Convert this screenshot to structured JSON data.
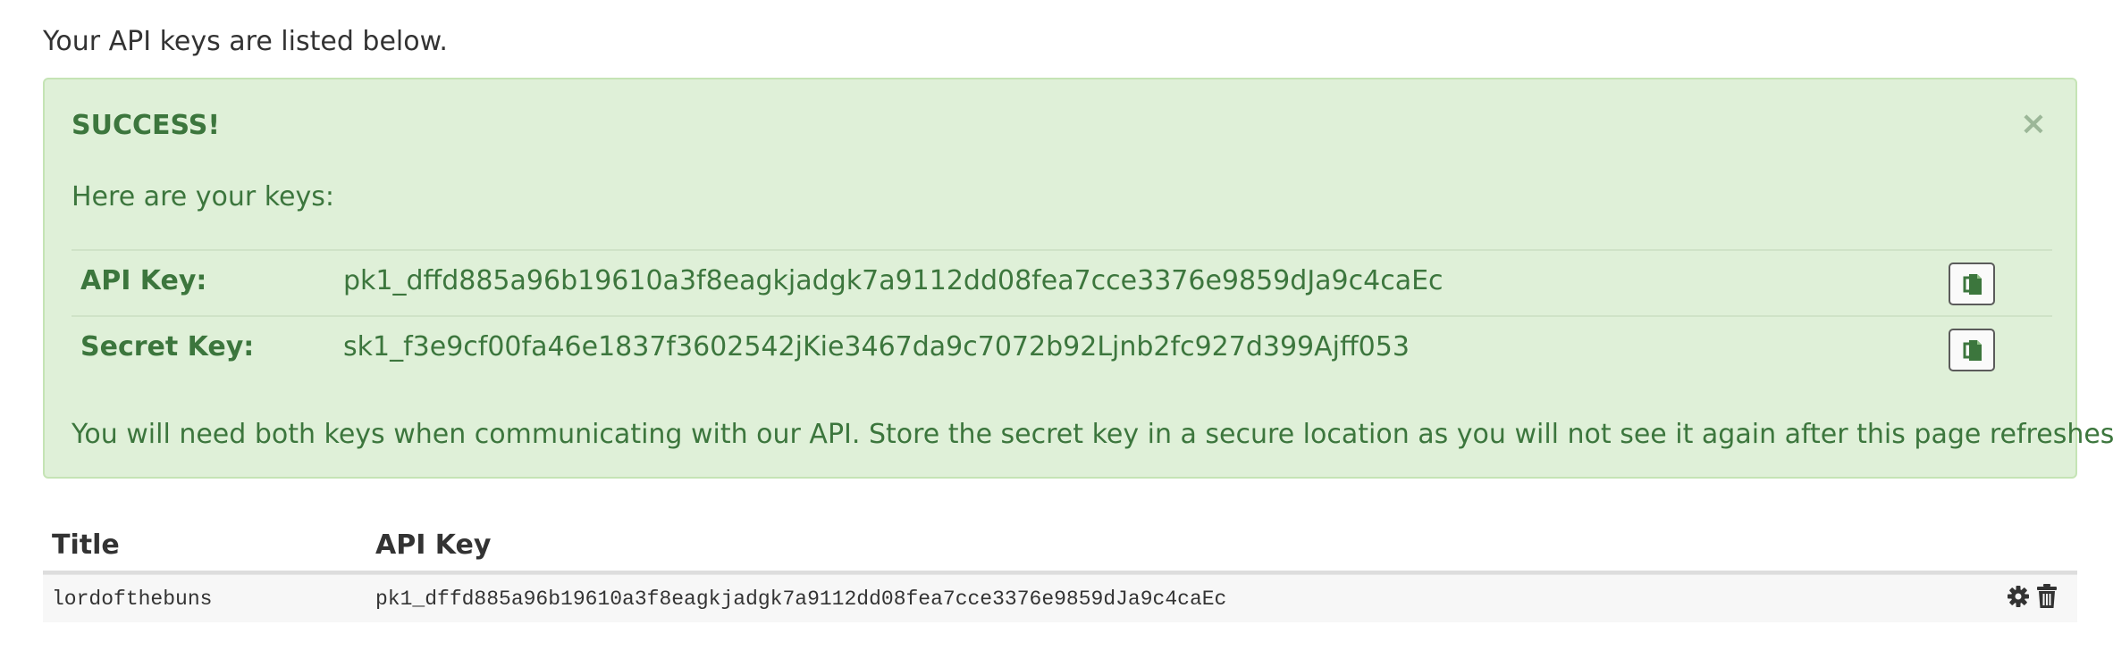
{
  "intro_text": "Your API keys are listed below.",
  "alert": {
    "heading": "SUCCESS!",
    "close_glyph": "×",
    "subtitle": "Here are your keys:",
    "keys": [
      {
        "label": "API Key:",
        "value": "pk1_dffd885a96b19610a3f8eagkjadgk7a9112dd08fea7cce3376e9859dJa9c4caEc"
      },
      {
        "label": "Secret Key:",
        "value": "sk1_f3e9cf00fa46e1837f3602542jKie3467da9c7072b92Ljnb2fc927d399Ajff053"
      }
    ],
    "note": "You will need both keys when communicating with our API. Store the secret key in a secure location as you will not see it again after this page refreshes.",
    "colors": {
      "background": "#dff0d8",
      "text": "#3c763d",
      "border": "#c5e4b5"
    }
  },
  "table": {
    "headers": {
      "title": "Title",
      "api_key": "API Key"
    },
    "rows": [
      {
        "title": "lordofthebuns",
        "api_key": "pk1_dffd885a96b19610a3f8eagkjadgk7a9112dd08fea7cce3376e9859dJa9c4caEc"
      }
    ]
  },
  "icons": {
    "copy": "copy-icon",
    "settings": "gear-icon",
    "delete": "trash-icon",
    "close": "close-icon"
  }
}
